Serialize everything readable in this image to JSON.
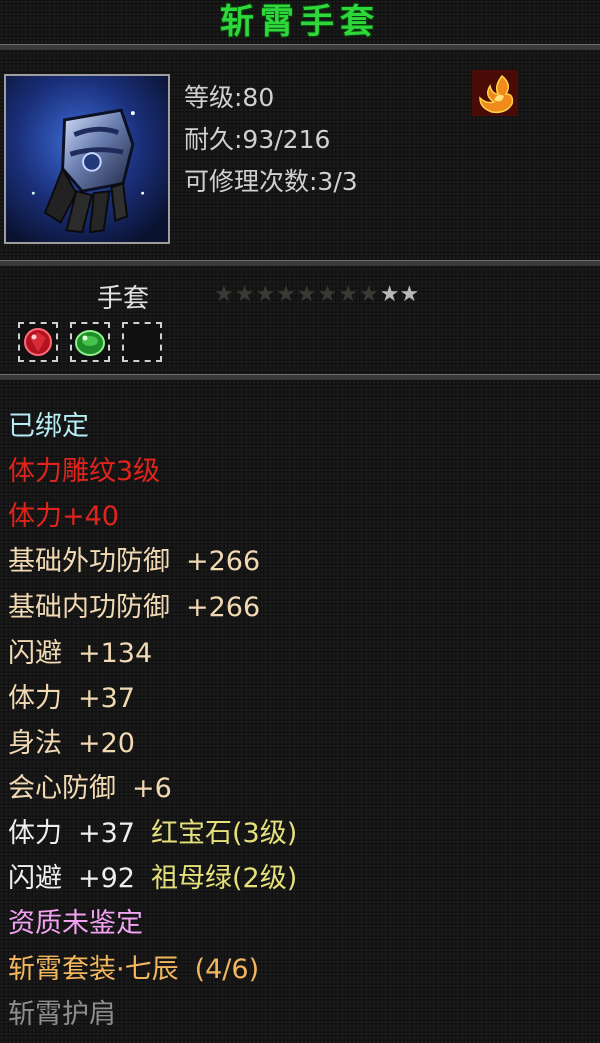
{
  "item": {
    "name": "斩霄手套",
    "level_label": "等级:80",
    "durability_label": "耐久:93/216",
    "repair_label": "可修理次数:3/3",
    "type": "手套",
    "stars": {
      "dim": "★★★★★★★★",
      "lit": "★★",
      "lit_count": 2,
      "total": 10
    }
  },
  "icons": {
    "portrait": "gauntlet-icon",
    "element": "fire-element-icon",
    "sockets": [
      "ruby-gem-icon",
      "emerald-gem-icon",
      "empty-socket-icon"
    ]
  },
  "colors": {
    "title": "#2fd83a",
    "bound": "#b6ecf4",
    "red_attr": "#e0241c",
    "base_attr": "#f1d9b3",
    "gem_name": "#e6e07a",
    "aptitude": "#f2a2f0",
    "set": "#f2b65f",
    "inactive": "#8d8d8d"
  },
  "attributes": {
    "bound": "已绑定",
    "engrave": "体力雕纹3级",
    "engrave_bonus": "体力+40",
    "base_ext_def": {
      "label": "基础外功防御",
      "value": "+266"
    },
    "base_int_def": {
      "label": "基础内功防御",
      "value": "+266"
    },
    "dodge": {
      "label": "闪避",
      "value": "+134"
    },
    "stamina": {
      "label": "体力",
      "value": "+37"
    },
    "agility": {
      "label": "身法",
      "value": "+20"
    },
    "crit_def": {
      "label": "会心防御",
      "value": "+6"
    },
    "gem1": {
      "label": "体力",
      "value": "+37",
      "gem": "红宝石(3级)"
    },
    "gem2": {
      "label": "闪避",
      "value": "+92",
      "gem": "祖母绿(2级)"
    },
    "aptitude": "资质未鉴定",
    "set_name": "斩霄套装·七辰",
    "set_count": "(4/6)",
    "set_piece": "斩霄护肩"
  }
}
